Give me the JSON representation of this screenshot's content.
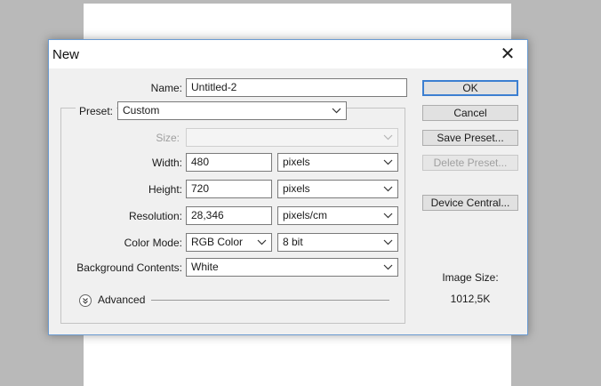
{
  "dialog": {
    "title": "New",
    "close_glyph": "✕"
  },
  "form": {
    "name_label": "Name:",
    "name_value": "Untitled-2",
    "preset_label": "Preset:",
    "preset_value": "Custom",
    "size_label": "Size:",
    "size_value": "",
    "width_label": "Width:",
    "width_value": "480",
    "width_unit": "pixels",
    "height_label": "Height:",
    "height_value": "720",
    "height_unit": "pixels",
    "resolution_label": "Resolution:",
    "resolution_value": "28,346",
    "resolution_unit": "pixels/cm",
    "color_mode_label": "Color Mode:",
    "color_mode_value": "RGB Color",
    "bit_depth_value": "8 bit",
    "background_label": "Background Contents:",
    "background_value": "White",
    "advanced_label": "Advanced"
  },
  "buttons": {
    "ok": "OK",
    "cancel": "Cancel",
    "save_preset": "Save Preset...",
    "delete_preset": "Delete Preset...",
    "device_central": "Device Central..."
  },
  "image_size": {
    "label": "Image Size:",
    "value": "1012,5K"
  },
  "icons": [
    "close-icon",
    "chevron-down-icon",
    "expand-advanced-icon"
  ],
  "colors": {
    "accent": "#3c7fd1",
    "dialog_bg": "#f0f0f0",
    "workspace_bg": "#b9b9b9"
  }
}
